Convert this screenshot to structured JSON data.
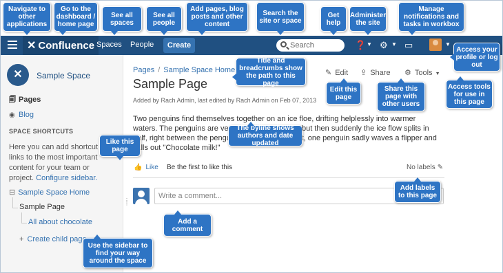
{
  "topnav": {
    "logo_text": "Confluence",
    "spaces": "Spaces",
    "people": "People",
    "create": "Create",
    "search_placeholder": "Search",
    "help_icon": "help-icon",
    "admin_icon": "gear-icon",
    "notifications_icon": "inbox-icon",
    "brand_color": "#205081"
  },
  "sidebar": {
    "space_name": "Sample Space",
    "pages": "Pages",
    "blog": "Blog",
    "shortcuts_heading": "SPACE SHORTCUTS",
    "shortcuts_desc": "Here you can add shortcut links to the most important content for your team or project.",
    "configure_link": "Configure sidebar.",
    "tree_root": "Sample Space Home",
    "tree_page": "Sample Page",
    "tree_child": "All about chocolate",
    "create_child": "Create child page"
  },
  "main": {
    "breadcrumb": [
      "Pages",
      "Sample Space Home"
    ],
    "title": "Sample Page",
    "byline": "Added by Rach Admin, last edited by Rach Admin on Feb 07, 2013",
    "edit": "Edit",
    "share": "Share",
    "tools": "Tools",
    "body": "Two penguins find themselves together on an ice floe, drifting helplessly into warmer waters. The penguins are very fond of each other, but then suddenly the ice flow splits in half, right between the penguins. As they drift apart, one penguin sadly waves a flipper and calls out \"Chocolate milk!\"",
    "like": "Like",
    "like_first": "Be the first to like this",
    "no_labels": "No labels",
    "comment_placeholder": "Write a comment..."
  },
  "callouts": {
    "navigate": "Navigate to other applications",
    "dashboard": "Go to the dashboard / home page",
    "spaces": "See all spaces",
    "people": "See all people",
    "add": "Add pages, blog posts and other content",
    "search": "Search the site or space",
    "help": "Get help",
    "admin": "Administer the site",
    "notifications": "Manage notifications and tasks in workbox",
    "profile": "Access your profile or log out",
    "title": "Title and breadcrumbs show the path to this page",
    "edit": "Edit this page",
    "share": "Share this page with other users",
    "tools": "Access tools for use in this page",
    "byline": "The byline shows authors and date updated",
    "like": "Like this page",
    "labels": "Add labels to this page",
    "comment": "Add a comment",
    "sidebar": "Use the sidebar to find your way around the space",
    "callout_color": "#2e74c4"
  }
}
